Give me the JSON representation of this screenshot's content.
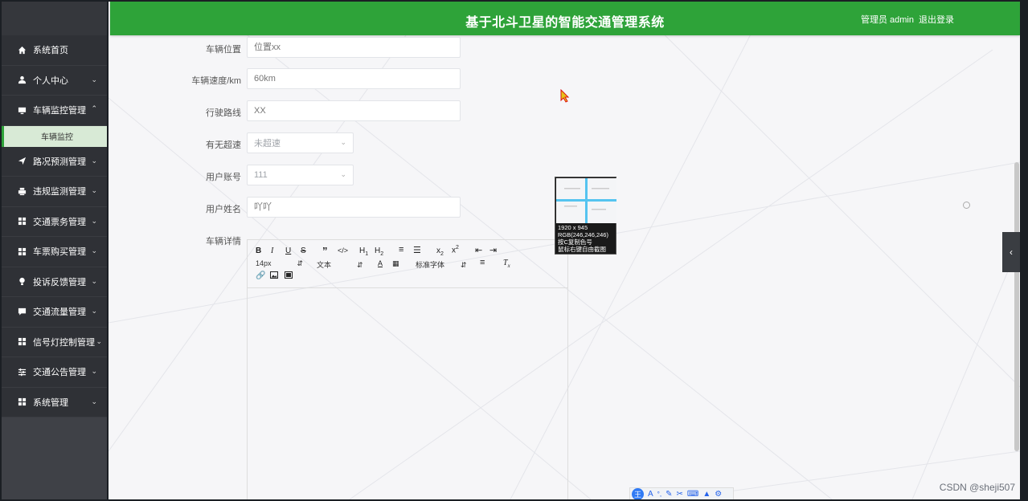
{
  "header": {
    "title": "基于北斗卫星的智能交通管理系统",
    "user": "管理员 admin",
    "logout": "退出登录"
  },
  "sidebar": {
    "items": [
      {
        "label": "系统首页",
        "icon": "home-icon"
      },
      {
        "label": "个人中心",
        "icon": "user-icon"
      },
      {
        "label": "车辆监控管理",
        "icon": "monitor-icon"
      },
      {
        "label": "车辆监控",
        "sub": true
      },
      {
        "label": "路况预测管理",
        "icon": "send-icon"
      },
      {
        "label": "违规监测管理",
        "icon": "printer-icon"
      },
      {
        "label": "交通票务管理",
        "icon": "grid-icon"
      },
      {
        "label": "车票购买管理",
        "icon": "grid-icon"
      },
      {
        "label": "投诉反馈管理",
        "icon": "bulb-icon"
      },
      {
        "label": "交通流量管理",
        "icon": "chat-icon"
      },
      {
        "label": "信号灯控制管理",
        "icon": "grid-icon"
      },
      {
        "label": "交通公告管理",
        "icon": "sliders-icon"
      },
      {
        "label": "系统管理",
        "icon": "grid-icon"
      }
    ]
  },
  "form": {
    "location": {
      "label": "车辆位置",
      "placeholder": "位置xx"
    },
    "speed": {
      "label": "车辆速度/km",
      "placeholder": "60km"
    },
    "route": {
      "label": "行驶路线",
      "placeholder": "XX"
    },
    "overspeed": {
      "label": "有无超速",
      "value": "未超速"
    },
    "account": {
      "label": "用户账号",
      "value": "111"
    },
    "name": {
      "label": "用户姓名",
      "placeholder": "吖吖"
    },
    "detail": {
      "label": "车辆详情"
    }
  },
  "editor": {
    "font_size": "14px",
    "text_style": "文本",
    "font_family": "标准字体"
  },
  "tooltip": {
    "line1": "1920 x 945",
    "line2": "RGB(246,246,246)",
    "line3": "按C复制色号",
    "line4": "鼠标右键自由截图"
  },
  "watermark": "CSDN @sheji507",
  "colors": {
    "accent": "#2ea339",
    "sidebar": "#2f3136"
  }
}
